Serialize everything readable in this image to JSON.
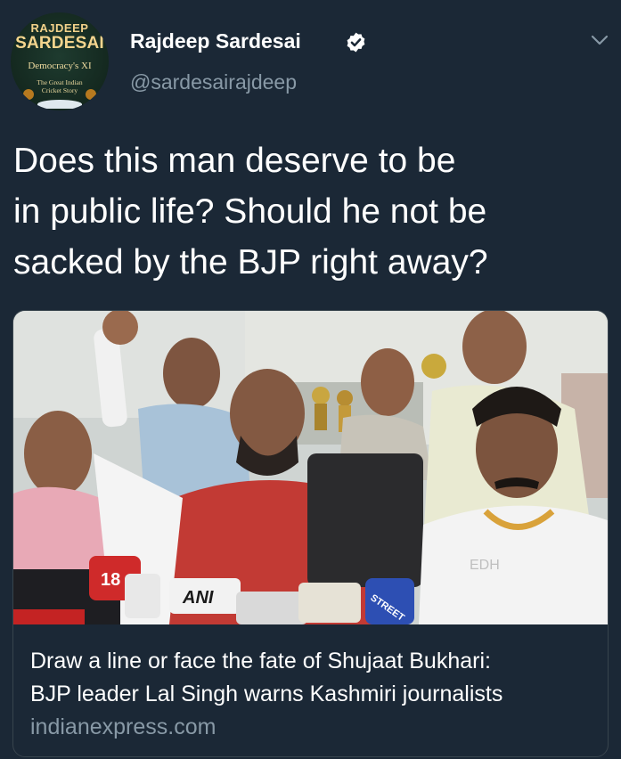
{
  "author": {
    "display_name": "Rajdeep Sardesai",
    "handle": "@sardesairajdeep",
    "verified": true,
    "avatar": {
      "line1": "RAJDEEP",
      "line2": "SARDESAI",
      "line3": "Democracy's XI",
      "line4": "The Great Indian Cricket Story"
    }
  },
  "tweet": {
    "text": "Does this man deserve to be\nin public life? Should he not be\nsacked by the BJP right away?"
  },
  "card": {
    "image_description_icon": "news-photo",
    "image_text": {
      "mic1": "18",
      "mic2": "ANI",
      "mic3": "STREET",
      "mic4": "EDH"
    },
    "title": "Draw a line or face the fate of Shujaat Bukhari:\nBJP leader Lal Singh warns Kashmiri journalists",
    "domain": "indianexpress.com"
  },
  "colors": {
    "background": "#1b2836",
    "secondary_text": "#8899a6",
    "border": "#38444d"
  },
  "icons": {
    "verified": "verified-badge-icon",
    "menu": "chevron-down-icon"
  }
}
